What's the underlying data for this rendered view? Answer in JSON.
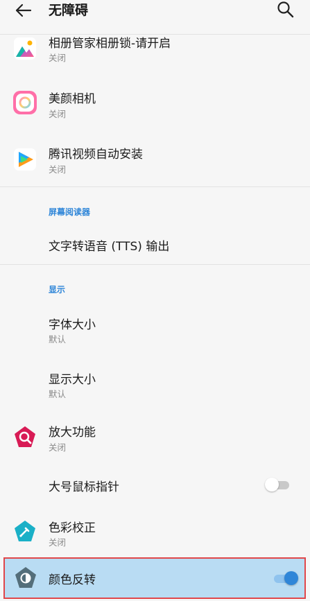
{
  "app_bar": {
    "title": "无障碍"
  },
  "apps": [
    {
      "label": "相册管家相册锁-请开启",
      "status": "关闭",
      "icon": "gallery-lock-app-icon"
    },
    {
      "label": "美颜相机",
      "status": "关闭",
      "icon": "beauty-camera-app-icon"
    },
    {
      "label": "腾讯视频自动安装",
      "status": "关闭",
      "icon": "tencent-video-app-icon"
    }
  ],
  "screen_reader": {
    "header": "屏幕阅读器",
    "tts_label": "文字转语音 (TTS) 输出"
  },
  "display": {
    "header": "显示",
    "font_size": {
      "label": "字体大小",
      "value": "默认"
    },
    "display_size": {
      "label": "显示大小",
      "value": "默认"
    },
    "magnification": {
      "label": "放大功能",
      "status": "关闭",
      "icon": "magnify-icon"
    },
    "large_pointer": {
      "label": "大号鼠标指针",
      "enabled": false
    },
    "color_correction": {
      "label": "色彩校正",
      "status": "关闭",
      "icon": "color-dropper-icon"
    },
    "color_inversion": {
      "label": "颜色反转",
      "enabled": true,
      "icon": "contrast-icon"
    }
  },
  "colors": {
    "accent": "#2f86d8",
    "highlight": "#b9dcf3",
    "highlight_border": "#e0464a",
    "magnify_icon": "#d81b55",
    "dropper_icon": "#1ab0c7",
    "invert_icon": "#546e7a"
  }
}
